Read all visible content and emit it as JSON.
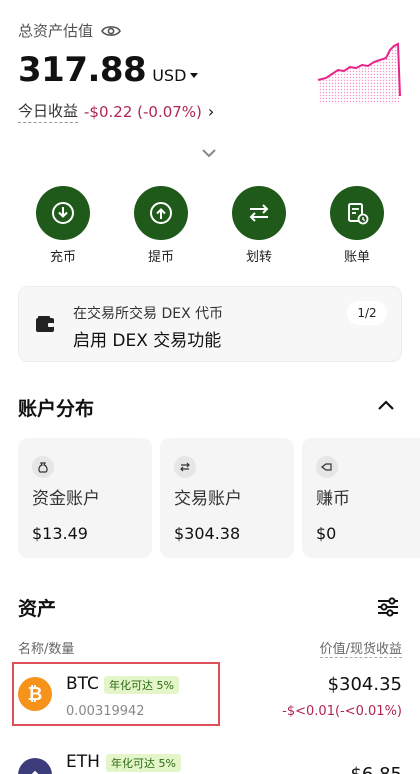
{
  "header": {
    "total_label": "总资产估值",
    "total_value": "317.88",
    "currency": "USD",
    "pnl_label": "今日收益",
    "pnl_value": "-$0.22 (-0.07%)"
  },
  "actions": [
    {
      "label": "充币",
      "icon": "download-icon"
    },
    {
      "label": "提币",
      "icon": "upload-icon"
    },
    {
      "label": "划转",
      "icon": "transfer-icon"
    },
    {
      "label": "账单",
      "icon": "bill-icon"
    }
  ],
  "promo": {
    "line1": "在交易所交易 DEX 代币",
    "line2": "启用 DEX 交易功能",
    "page": "1/2"
  },
  "account_section": {
    "title": "账户分布",
    "cards": [
      {
        "name": "资金账户",
        "value": "$13.49",
        "icon": "wallet-icon"
      },
      {
        "name": "交易账户",
        "value": "$304.38",
        "icon": "swap-icon"
      },
      {
        "name": "赚币",
        "value": "$0",
        "icon": "earn-icon"
      }
    ]
  },
  "assets_section": {
    "title": "资产",
    "col_left": "名称/数量",
    "col_right": "价值/现货收益",
    "items": [
      {
        "name": "BTC",
        "badge": "年化可达 5%",
        "qty": "0.00319942",
        "value": "$304.35",
        "pnl": "-$<0.01(-<0.01%)",
        "color": "#f7931a",
        "symbol": "₿"
      },
      {
        "name": "ETH",
        "badge": "年化可达 5%",
        "qty": "",
        "value": "$6.85",
        "pnl": "",
        "color": "#3c3c7a",
        "symbol": "◆"
      }
    ]
  },
  "colors": {
    "accent": "#1f5a1a",
    "negative": "#b0264f",
    "sparkline": "#e8258a"
  }
}
